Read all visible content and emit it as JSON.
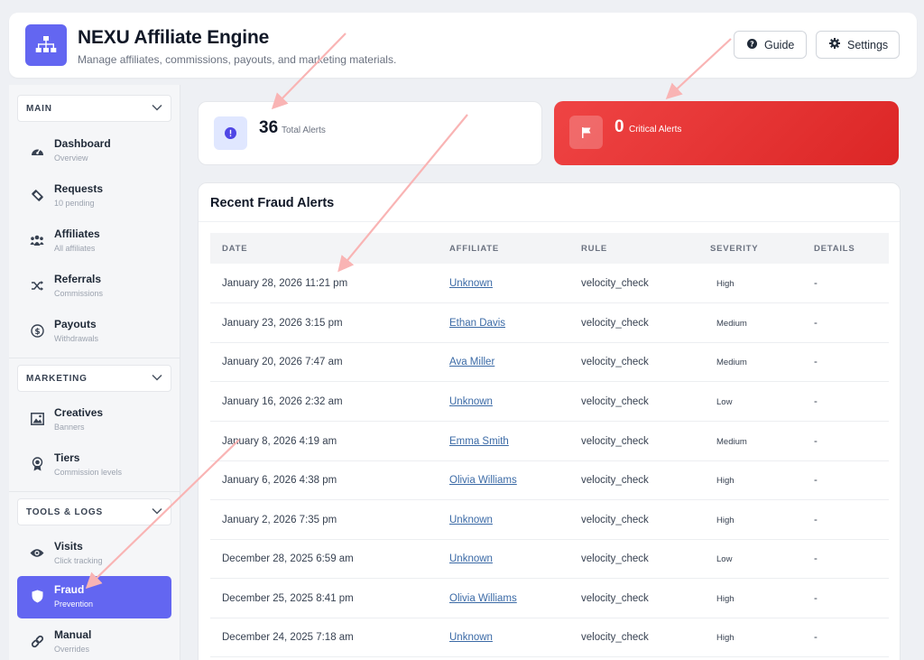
{
  "header": {
    "title": "NEXU Affiliate Engine",
    "subtitle": "Manage affiliates, commissions, payouts, and marketing materials.",
    "guide_label": "Guide",
    "settings_label": "Settings"
  },
  "sidebar": {
    "sections": [
      {
        "title": "MAIN"
      },
      {
        "title": "MARKETING"
      },
      {
        "title": "TOOLS & LOGS"
      }
    ],
    "items": [
      {
        "label": "Dashboard",
        "sub": "Overview",
        "icon": "gauge-icon"
      },
      {
        "label": "Requests",
        "sub": "10 pending",
        "icon": "ticket-icon"
      },
      {
        "label": "Affiliates",
        "sub": "All affiliates",
        "icon": "users-icon"
      },
      {
        "label": "Referrals",
        "sub": "Commissions",
        "icon": "shuffle-icon"
      },
      {
        "label": "Payouts",
        "sub": "Withdrawals",
        "icon": "dollar-icon"
      },
      {
        "label": "Creatives",
        "sub": "Banners",
        "icon": "image-icon"
      },
      {
        "label": "Tiers",
        "sub": "Commission levels",
        "icon": "award-icon"
      },
      {
        "label": "Visits",
        "sub": "Click tracking",
        "icon": "eye-icon"
      },
      {
        "label": "Fraud",
        "sub": "Prevention",
        "icon": "shield-icon"
      },
      {
        "label": "Manual",
        "sub": "Overrides",
        "icon": "link-icon"
      }
    ]
  },
  "stats": {
    "total": {
      "value": "36",
      "label": "Total Alerts"
    },
    "critical": {
      "value": "0",
      "label": "Critical Alerts"
    }
  },
  "alerts": {
    "title": "Recent Fraud Alerts",
    "columns": [
      "DATE",
      "AFFILIATE",
      "RULE",
      "SEVERITY",
      "DETAILS"
    ],
    "rows": [
      {
        "date": "January 28, 2026 11:21 pm",
        "affiliate": "Unknown",
        "rule": "velocity_check",
        "severity": "High",
        "details": "-"
      },
      {
        "date": "January 23, 2026 3:15 pm",
        "affiliate": "Ethan Davis",
        "rule": "velocity_check",
        "severity": "Medium",
        "details": "-"
      },
      {
        "date": "January 20, 2026 7:47 am",
        "affiliate": "Ava Miller",
        "rule": "velocity_check",
        "severity": "Medium",
        "details": "-"
      },
      {
        "date": "January 16, 2026 2:32 am",
        "affiliate": "Unknown",
        "rule": "velocity_check",
        "severity": "Low",
        "details": "-"
      },
      {
        "date": "January 8, 2026 4:19 am",
        "affiliate": "Emma Smith",
        "rule": "velocity_check",
        "severity": "Medium",
        "details": "-"
      },
      {
        "date": "January 6, 2026 4:38 pm",
        "affiliate": "Olivia Williams",
        "rule": "velocity_check",
        "severity": "High",
        "details": "-"
      },
      {
        "date": "January 2, 2026 7:35 pm",
        "affiliate": "Unknown",
        "rule": "velocity_check",
        "severity": "High",
        "details": "-"
      },
      {
        "date": "December 28, 2025 6:59 am",
        "affiliate": "Unknown",
        "rule": "velocity_check",
        "severity": "Low",
        "details": "-"
      },
      {
        "date": "December 25, 2025 8:41 pm",
        "affiliate": "Olivia Williams",
        "rule": "velocity_check",
        "severity": "High",
        "details": "-"
      },
      {
        "date": "December 24, 2025 7:18 am",
        "affiliate": "Unknown",
        "rule": "velocity_check",
        "severity": "High",
        "details": "-"
      }
    ]
  },
  "colors": {
    "accent": "#6366f1",
    "critical": "#ef4444",
    "link": "#3b6aa6",
    "annotation_arrow": "#f9b4b4"
  }
}
